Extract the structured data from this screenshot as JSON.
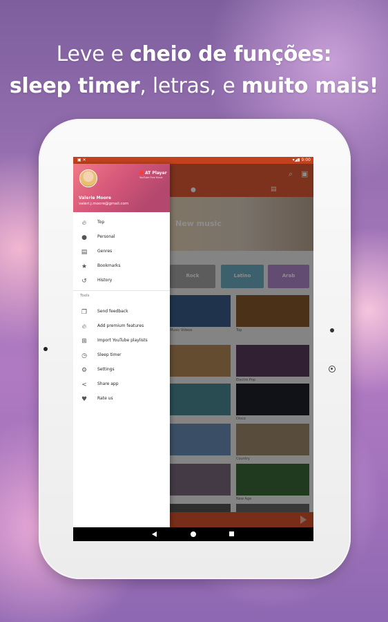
{
  "headline": {
    "line1_light": "Leve e ",
    "line1_bold": "cheio de funções:",
    "line2_bold_a": "sleep timer",
    "line2_light": ", letras, e ",
    "line2_bold_b": "muito mais!"
  },
  "statusbar": {
    "time": "9:00"
  },
  "background": {
    "banner_title": "New music",
    "genres": [
      "Rock",
      "Latino",
      "Arab"
    ],
    "captions": [
      "Music Videos",
      "Top",
      "Electro Pop",
      "Disco",
      "Country",
      "New Age"
    ]
  },
  "drawer": {
    "user_name": "Valerie Moore",
    "user_email": "valeri.j.moore@gmail.com",
    "app_name": "AT Player",
    "app_tagline": "YouTube Free Music",
    "items": [
      {
        "label": "Top",
        "icon": "fire-icon"
      },
      {
        "label": "Personal",
        "icon": "person-icon"
      },
      {
        "label": "Genres",
        "icon": "library-icon"
      },
      {
        "label": "Bookmarks",
        "icon": "star-icon"
      },
      {
        "label": "History",
        "icon": "history-icon"
      }
    ],
    "tools_label": "Tools",
    "tools": [
      {
        "label": "Send feedback",
        "icon": "feedback-icon"
      },
      {
        "label": "Add premium features",
        "icon": "fire-icon"
      },
      {
        "label": "Import YouTube playlists",
        "icon": "add-playlist-icon"
      },
      {
        "label": "Sleep timer",
        "icon": "timer-icon"
      },
      {
        "label": "Settings",
        "icon": "gear-icon"
      },
      {
        "label": "Share app",
        "icon": "share-icon"
      },
      {
        "label": "Rate us",
        "icon": "heart-icon"
      }
    ]
  },
  "colors": {
    "accent": "#e25b36",
    "status": "#c3421e"
  }
}
